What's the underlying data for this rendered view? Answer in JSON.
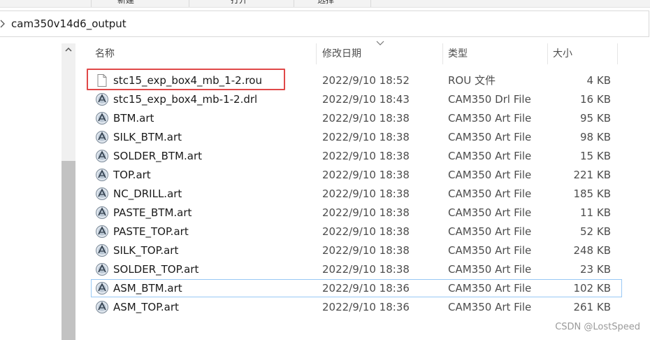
{
  "address": {
    "path": "cam350v14d6_output"
  },
  "ribbon": {
    "labels": [
      "新建",
      "打开",
      "选择"
    ]
  },
  "header": {
    "name": "名称",
    "date": "修改日期",
    "type": "类型",
    "size": "大小",
    "sorted_column": "name"
  },
  "files": [
    {
      "name": "stc15_exp_box4_mb_1-2.rou",
      "date": "2022/9/10 18:52",
      "type": "ROU 文件",
      "size": "4 KB",
      "icon": "blank-file-icon"
    },
    {
      "name": "stc15_exp_box4_mb-1-2.drl",
      "date": "2022/9/10 18:43",
      "type": "CAM350 Drl File",
      "size": "16 KB",
      "icon": "cam350-file-icon"
    },
    {
      "name": "BTM.art",
      "date": "2022/9/10 18:38",
      "type": "CAM350 Art File",
      "size": "95 KB",
      "icon": "cam350-file-icon"
    },
    {
      "name": "SILK_BTM.art",
      "date": "2022/9/10 18:38",
      "type": "CAM350 Art File",
      "size": "98 KB",
      "icon": "cam350-file-icon"
    },
    {
      "name": "SOLDER_BTM.art",
      "date": "2022/9/10 18:38",
      "type": "CAM350 Art File",
      "size": "15 KB",
      "icon": "cam350-file-icon"
    },
    {
      "name": "TOP.art",
      "date": "2022/9/10 18:38",
      "type": "CAM350 Art File",
      "size": "221 KB",
      "icon": "cam350-file-icon"
    },
    {
      "name": "NC_DRILL.art",
      "date": "2022/9/10 18:38",
      "type": "CAM350 Art File",
      "size": "185 KB",
      "icon": "cam350-file-icon"
    },
    {
      "name": "PASTE_BTM.art",
      "date": "2022/9/10 18:38",
      "type": "CAM350 Art File",
      "size": "11 KB",
      "icon": "cam350-file-icon"
    },
    {
      "name": "PASTE_TOP.art",
      "date": "2022/9/10 18:38",
      "type": "CAM350 Art File",
      "size": "52 KB",
      "icon": "cam350-file-icon"
    },
    {
      "name": "SILK_TOP.art",
      "date": "2022/9/10 18:38",
      "type": "CAM350 Art File",
      "size": "248 KB",
      "icon": "cam350-file-icon"
    },
    {
      "name": "SOLDER_TOP.art",
      "date": "2022/9/10 18:38",
      "type": "CAM350 Art File",
      "size": "23 KB",
      "icon": "cam350-file-icon"
    },
    {
      "name": "ASM_BTM.art",
      "date": "2022/9/10 18:36",
      "type": "CAM350 Art File",
      "size": "102 KB",
      "icon": "cam350-file-icon"
    },
    {
      "name": "ASM_TOP.art",
      "date": "2022/9/10 18:36",
      "type": "CAM350 Art File",
      "size": "261 KB",
      "icon": "cam350-file-icon"
    }
  ],
  "highlighted_file": "stc15_exp_box4_mb_1-2.rou",
  "focused_file": "ASM_BTM.art",
  "watermark": "CSDN @LostSpeed",
  "colors": {
    "highlight_box": "#e04848",
    "focus_outline": "#99c9f5",
    "scroll_thumb": "#c2c2c2"
  }
}
